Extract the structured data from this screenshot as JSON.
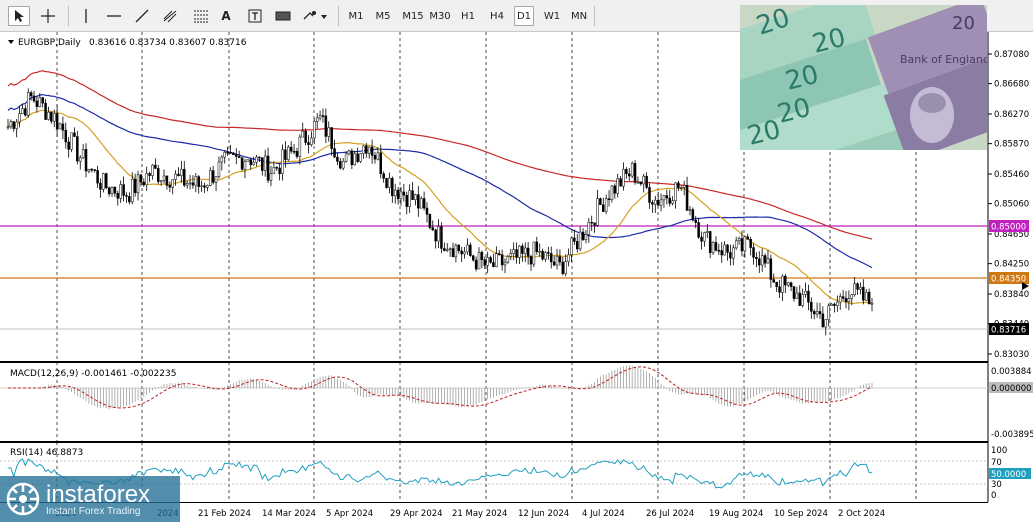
{
  "toolbar": {
    "timeframes": [
      "M1",
      "M5",
      "M15",
      "M30",
      "H1",
      "H4",
      "D1",
      "W1",
      "MN"
    ],
    "active_timeframe": "D1"
  },
  "chart": {
    "header": "EURGBP,Daily",
    "ohlc": "0.83616 0.83734 0.83607 0.83716",
    "price_ticks": [
      "0.87080",
      "0.86680",
      "0.86270",
      "0.85870",
      "0.85460",
      "0.85060",
      "0.84650",
      "0.84250",
      "0.83840",
      "0.83440",
      "0.83030"
    ],
    "price_tags": {
      "level_a": "0.85000",
      "level_b": "0.84350",
      "current": "0.83716"
    },
    "x_labels": [
      "21 Feb 2024",
      "14 Mar 2024",
      "5 Apr 2024",
      "29 Apr 2024",
      "21 May 2024",
      "12 Jun 2024",
      "4 Jul 2024",
      "26 Jul 2024",
      "19 Aug 2024",
      "10 Sep 2024",
      "2 Oct 2024"
    ],
    "x_labels_partial": [
      "2024",
      "2024"
    ],
    "colors": {
      "ma_fast": "#d4a020",
      "ma_mid": "#1c2ca8",
      "ma_slow": "#c82828",
      "level_a_line": "#c020c0",
      "level_b_line": "#d07810",
      "candle": "#000000",
      "macd_signal": "#c02020",
      "rsi_line": "#20a0c0"
    }
  },
  "macd": {
    "label": "MACD(12,26,9) -0.001461 -0.002235",
    "ticks": [
      "0.003884",
      "0.000000",
      "-0.003895"
    ]
  },
  "rsi": {
    "label": "RSI(14) 46.8873",
    "ticks": [
      "100",
      "70",
      "50.0000",
      "30",
      "0"
    ]
  },
  "logo": {
    "name": "instaforex",
    "tagline": "Instant Forex Trading"
  },
  "chart_data": {
    "type": "candlestick",
    "title": "EURGBP,Daily",
    "ylim": [
      0.8303,
      0.8708
    ],
    "horizontal_levels": [
      0.85,
      0.8435
    ],
    "last_close": 0.83716,
    "approx_closes": [
      0.861,
      0.865,
      0.862,
      0.857,
      0.853,
      0.852,
      0.855,
      0.854,
      0.853,
      0.856,
      0.857,
      0.855,
      0.858,
      0.862,
      0.856,
      0.859,
      0.853,
      0.851,
      0.846,
      0.844,
      0.842,
      0.843,
      0.844,
      0.842,
      0.847,
      0.852,
      0.855,
      0.851,
      0.853,
      0.846,
      0.844,
      0.845,
      0.84,
      0.838,
      0.835,
      0.839,
      0.837
    ]
  }
}
